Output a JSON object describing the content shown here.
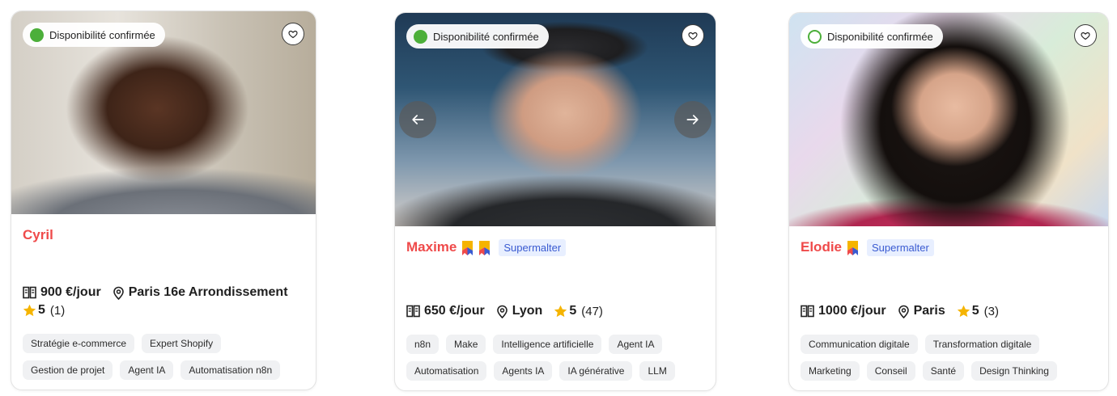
{
  "cards": [
    {
      "badge": "Disponibilité confirmée",
      "badge_style": "filled",
      "name": "Cyril",
      "supermalter": "",
      "ribbons": 0,
      "rate": "900 €/jour",
      "location": "Paris 16e Arrondissement",
      "rating": "5",
      "reviews": "(1)",
      "has_carousel": false,
      "tags": [
        "Stratégie e-commerce",
        "Expert Shopify",
        "Gestion de projet",
        "Agent IA",
        "Automatisation n8n"
      ]
    },
    {
      "badge": "Disponibilité confirmée",
      "badge_style": "filled",
      "name": "Maxime",
      "supermalter": "Supermalter",
      "ribbons": 2,
      "rate": "650 €/jour",
      "location": "Lyon",
      "rating": "5",
      "reviews": "(47)",
      "has_carousel": true,
      "tags": [
        "n8n",
        "Make",
        "Intelligence artificielle",
        "Agent IA",
        "Automatisation",
        "Agents IA",
        "IA générative",
        "LLM"
      ]
    },
    {
      "badge": "Disponibilité confirmée",
      "badge_style": "hollow",
      "name": "Elodie",
      "supermalter": "Supermalter",
      "ribbons": 1,
      "rate": "1000 €/jour",
      "location": "Paris",
      "rating": "5",
      "reviews": "(3)",
      "has_carousel": false,
      "tags": [
        "Communication digitale",
        "Transformation digitale",
        "Marketing",
        "Conseil",
        "Santé",
        "Design Thinking"
      ]
    }
  ],
  "icons": {
    "availability": "status-dot-icon",
    "favorite": "heart-icon",
    "rate": "book-icon",
    "location": "map-pin-icon",
    "rating": "star-icon",
    "ribbon": "ribbon-icon",
    "prev": "arrow-left-icon",
    "next": "arrow-right-icon"
  },
  "colors": {
    "name": "#ef4a4a",
    "available": "#4caf3a",
    "star": "#f5b400",
    "supermalter_bg": "#e8efff",
    "supermalter_text": "#3a5bd1",
    "tag_bg": "#f0f1f3"
  }
}
